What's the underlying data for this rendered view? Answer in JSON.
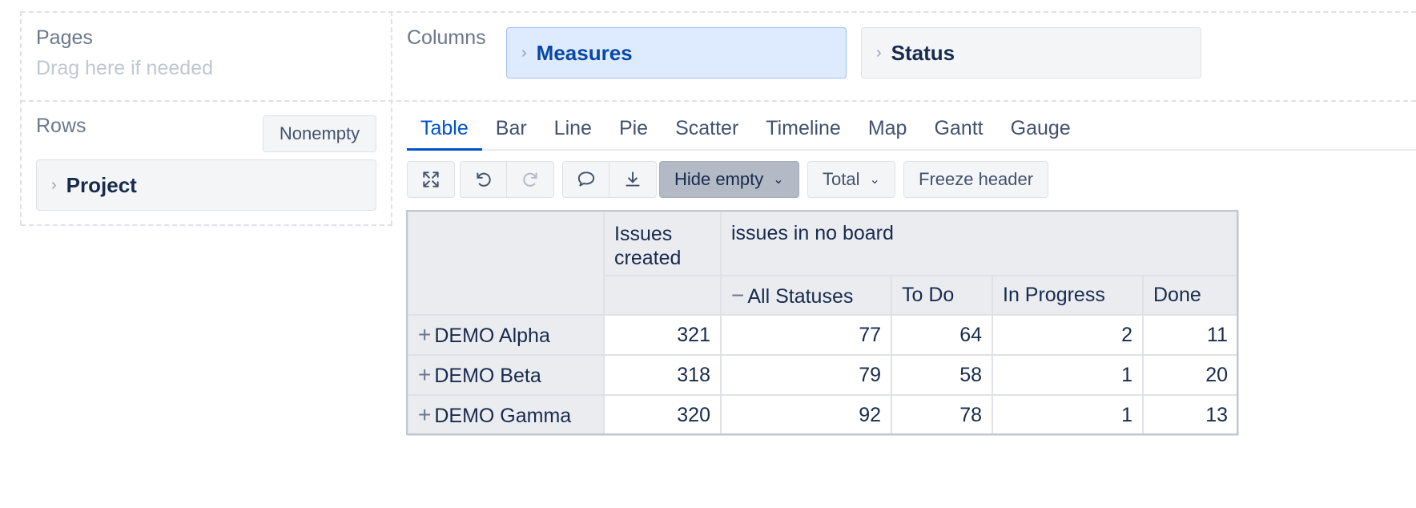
{
  "layout_panel": {
    "pages": {
      "label": "Pages",
      "hint": "Drag here if needed"
    },
    "columns": {
      "label": "Columns",
      "dimensions": [
        "Measures",
        "Status"
      ]
    },
    "rows": {
      "label": "Rows",
      "nonempty_label": "Nonempty",
      "dimensions": [
        "Project"
      ]
    }
  },
  "tabs": [
    "Table",
    "Bar",
    "Line",
    "Pie",
    "Scatter",
    "Timeline",
    "Map",
    "Gantt",
    "Gauge"
  ],
  "active_tab": "Table",
  "toolbar": {
    "icons": [
      "expand-icon",
      "undo-icon",
      "redo-icon",
      "comment-icon",
      "export-icon"
    ],
    "hide_empty_label": "Hide empty",
    "total_label": "Total",
    "freeze_header_label": "Freeze header"
  },
  "table": {
    "measure_header": "Issues created",
    "board_header": "issues in no board",
    "status_headers": [
      "All Statuses",
      "To Do",
      "In Progress",
      "Done"
    ],
    "rows": [
      {
        "label": "DEMO Alpha",
        "issues_created": "321",
        "all_statuses": "77",
        "to_do": "64",
        "in_progress": "2",
        "done": "11"
      },
      {
        "label": "DEMO Beta",
        "issues_created": "318",
        "all_statuses": "79",
        "to_do": "58",
        "in_progress": "1",
        "done": "20"
      },
      {
        "label": "DEMO Gamma",
        "issues_created": "320",
        "all_statuses": "92",
        "to_do": "78",
        "in_progress": "1",
        "done": "13"
      }
    ]
  },
  "colors": {
    "accent": "#0052cc",
    "measures_chip_bg": "#deebff",
    "header_bg": "#ebecf0"
  }
}
